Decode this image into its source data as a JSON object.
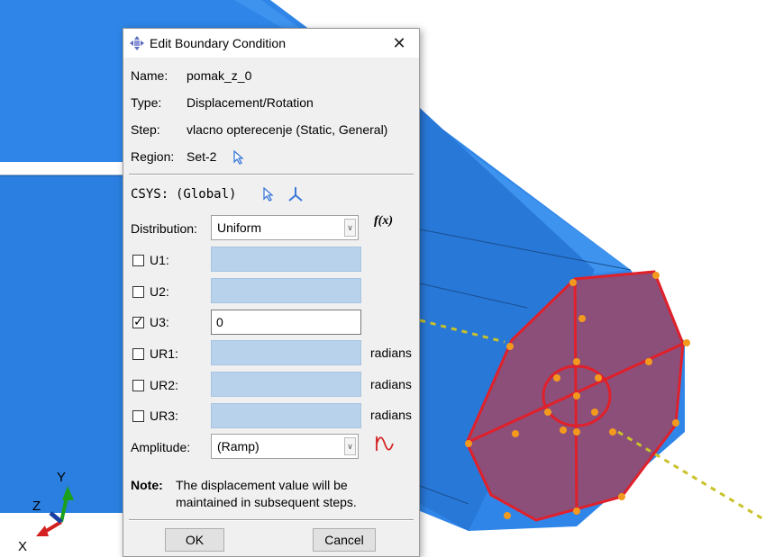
{
  "viewport": {
    "triad": {
      "x_label": "X",
      "y_label": "Y",
      "z_label": "Z"
    }
  },
  "dialog": {
    "title": "Edit Boundary Condition",
    "close_glyph": "✕",
    "name_label": "Name:",
    "name_value": "pomak_z_0",
    "type_label": "Type:",
    "type_value": "Displacement/Rotation",
    "step_label": "Step:",
    "step_value": "vlacno opterecenje (Static, General)",
    "region_label": "Region:",
    "region_value": "Set-2",
    "csys_label": "CSYS:",
    "csys_value": "(Global)",
    "distribution_label": "Distribution:",
    "distribution_value": "Uniform",
    "fx_label": "f(x)",
    "dofs": [
      {
        "label": "U1:",
        "checked": false,
        "value": "",
        "unit": ""
      },
      {
        "label": "U2:",
        "checked": false,
        "value": "",
        "unit": ""
      },
      {
        "label": "U3:",
        "checked": true,
        "value": "0",
        "unit": ""
      },
      {
        "label": "UR1:",
        "checked": false,
        "value": "",
        "unit": "radians"
      },
      {
        "label": "UR2:",
        "checked": false,
        "value": "",
        "unit": "radians"
      },
      {
        "label": "UR3:",
        "checked": false,
        "value": "",
        "unit": "radians"
      }
    ],
    "amplitude_label": "Amplitude:",
    "amplitude_value": "(Ramp)",
    "note_label": "Note:",
    "note_line1": "The displacement value will be",
    "note_line2": "maintained in subsequent steps.",
    "ok_label": "OK",
    "cancel_label": "Cancel"
  },
  "colors": {
    "cylinder": "#2f86e8",
    "face_fill": "#8b4f7a",
    "face_edge": "#e0202a",
    "marker": "#f39a1e",
    "axis_line": "#c9c229",
    "disabled_field": "#b8d2ec"
  }
}
